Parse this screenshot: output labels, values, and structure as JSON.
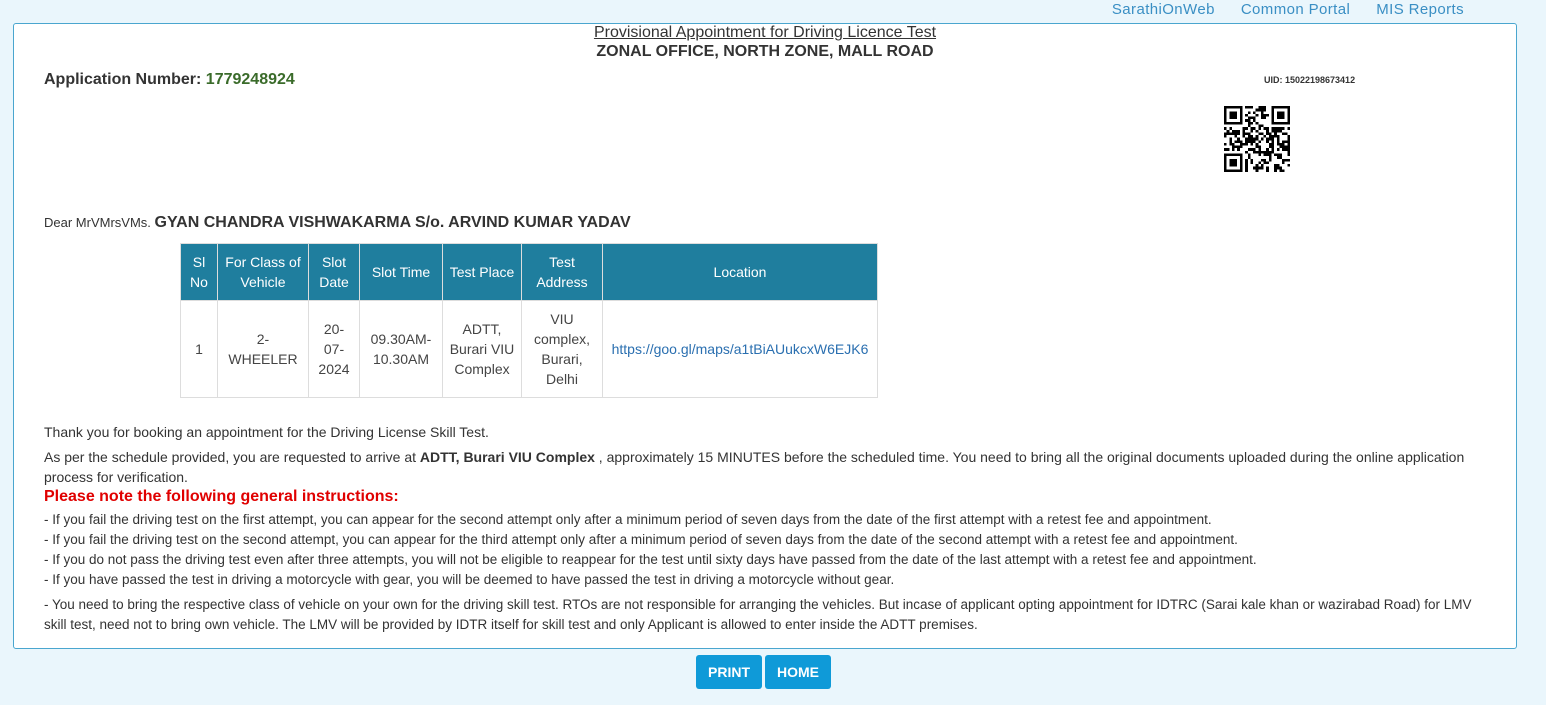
{
  "nav": {
    "links": [
      "SarathiOnWeb",
      "Common Portal",
      "MIS Reports"
    ]
  },
  "header": {
    "title": "Provisional Appointment for Driving Licence Test",
    "office": "ZONAL OFFICE, NORTH ZONE, MALL ROAD"
  },
  "application": {
    "label": "Application Number:",
    "number": "1779248924",
    "uid": "UID: 15022198673412"
  },
  "greeting": {
    "prefix": "Dear MrVMrsVMs.",
    "name": "GYAN CHANDRA VISHWAKARMA S/o. ARVIND KUMAR YADAV"
  },
  "table": {
    "headers": [
      "Sl No",
      "For Class of Vehicle",
      "Slot Date",
      "Slot Time",
      "Test Place",
      "Test Address",
      "Location"
    ],
    "rows": [
      {
        "sl_no": "1",
        "class": "2-WHEELER",
        "date": "20-07-2024",
        "time": "09.30AM-10.30AM",
        "place": "ADTT, Burari VIU Complex",
        "address": "VIU complex, Burari, Delhi",
        "location": "https://goo.gl/maps/a1tBiAUukcxW6EJK6"
      }
    ]
  },
  "text": {
    "thanks": "Thank you for booking an appointment for the Driving License Skill Test.",
    "schedule_pre": "As per the schedule provided, you are requested to arrive at ",
    "schedule_place": "ADTT, Burari VIU Complex",
    "schedule_post": " , approximately 15 MINUTES before the scheduled time. You need to bring all the original documents uploaded during the online application process for verification.",
    "note_heading": "Please note the following general instructions:",
    "instructions": [
      "- If you fail the driving test on the first attempt, you can appear for the second attempt only after a minimum period of seven days from the date of the first attempt with a retest fee and appointment.",
      "- If you fail the driving test on the second attempt, you can appear for the third attempt only after a minimum period of seven days from the date of the second attempt with a retest fee and appointment.",
      "- If you do not pass the driving test even after three attempts, you will not be eligible to reappear for the test until sixty days have passed from the date of the last attempt with a retest fee and appointment.",
      "- If you have passed the test in driving a motorcycle with gear, you will be deemed to have passed the test in driving a motorcycle without gear."
    ],
    "vehicle_note": "- You need to bring the respective class of vehicle on your own for the driving skill test. RTOs are not responsible for arranging the vehicles. But incase of applicant opting appointment for IDTRC (Sarai kale khan or wazirabad Road) for LMV skill test, need not to bring own vehicle. The LMV will be provided by IDTR itself for skill test and only Applicant is allowed to enter inside the ADTT premises."
  },
  "buttons": {
    "print": "PRINT",
    "home": "HOME"
  },
  "colors": {
    "table_header": "#1f7e9e",
    "button": "#0f9ad8",
    "note": "#e00000",
    "app_number": "#3a6b2a"
  }
}
